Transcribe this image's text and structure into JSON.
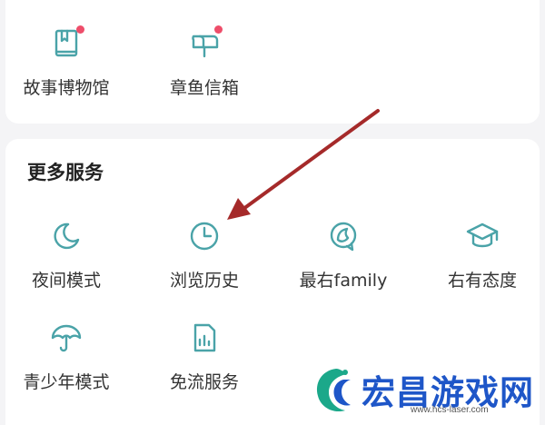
{
  "top_items": [
    {
      "label": "故事博物馆",
      "icon": "museum-book-icon",
      "badge": true
    },
    {
      "label": "章鱼信箱",
      "icon": "mailbox-icon",
      "badge": true
    }
  ],
  "more_services": {
    "title": "更多服务",
    "items": [
      {
        "label": "夜间模式",
        "icon": "moon-icon"
      },
      {
        "label": "浏览历史",
        "icon": "clock-icon"
      },
      {
        "label": "最右family",
        "icon": "family-icon"
      },
      {
        "label": "右有态度",
        "icon": "graduation-cap-icon"
      },
      {
        "label": "青少年模式",
        "icon": "umbrella-icon"
      },
      {
        "label": "免流服务",
        "icon": "sim-card-icon"
      }
    ]
  },
  "watermark": {
    "text": "宏昌游戏网",
    "url": "www.hcs-laser.com"
  },
  "colors": {
    "accent": "#4aa3a8",
    "badge": "#ee4d6a",
    "arrow": "#a52a2a",
    "watermark": "#1e56c8"
  }
}
